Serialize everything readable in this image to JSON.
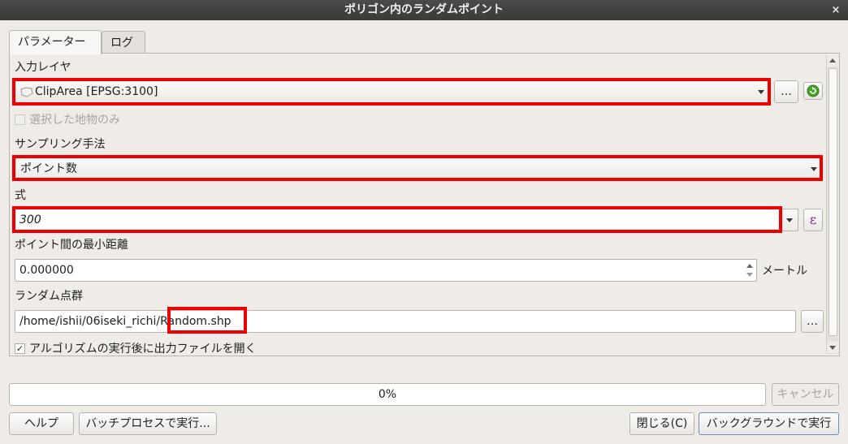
{
  "window": {
    "title": "ポリゴン内のランダムポイント",
    "close_glyph": "×"
  },
  "tabs": [
    {
      "label": "パラメーター",
      "active": true
    },
    {
      "label": "ログ",
      "active": false
    }
  ],
  "params": {
    "input_layer": {
      "label": "入力レイヤ",
      "value": "ClipArea [EPSG:3100]",
      "browse_label": "…",
      "icon": "polygon-layer-icon"
    },
    "selected_only": {
      "label": "選択した地物のみ",
      "checked": false,
      "enabled": false
    },
    "sampling": {
      "label": "サンプリング手法",
      "value": "ポイント数"
    },
    "expression": {
      "label": "式",
      "value": "300",
      "expr_button": "ε"
    },
    "min_distance": {
      "label": "ポイント間の最小距離",
      "value": "0.000000",
      "unit": "メートル"
    },
    "output": {
      "label": "ランダム点群",
      "value_prefix": "/home/ishii/06iseki_richi",
      "value_file": "/Random.shp",
      "browse_label": "…"
    },
    "open_after": {
      "label": "アルゴリズムの実行後に出力ファイルを開く",
      "checked": true
    }
  },
  "progress": {
    "text": "0%",
    "value": 0
  },
  "buttons": {
    "cancel": "キャンセル",
    "help": "ヘルプ",
    "batch": "バッチプロセスで実行...",
    "close": "閉じる(C)",
    "run": "バックグラウンドで実行"
  },
  "colors": {
    "highlight": "#ee0000",
    "titlebar": "#3f3f3d",
    "accent_button_border": "#6a8fc0"
  }
}
